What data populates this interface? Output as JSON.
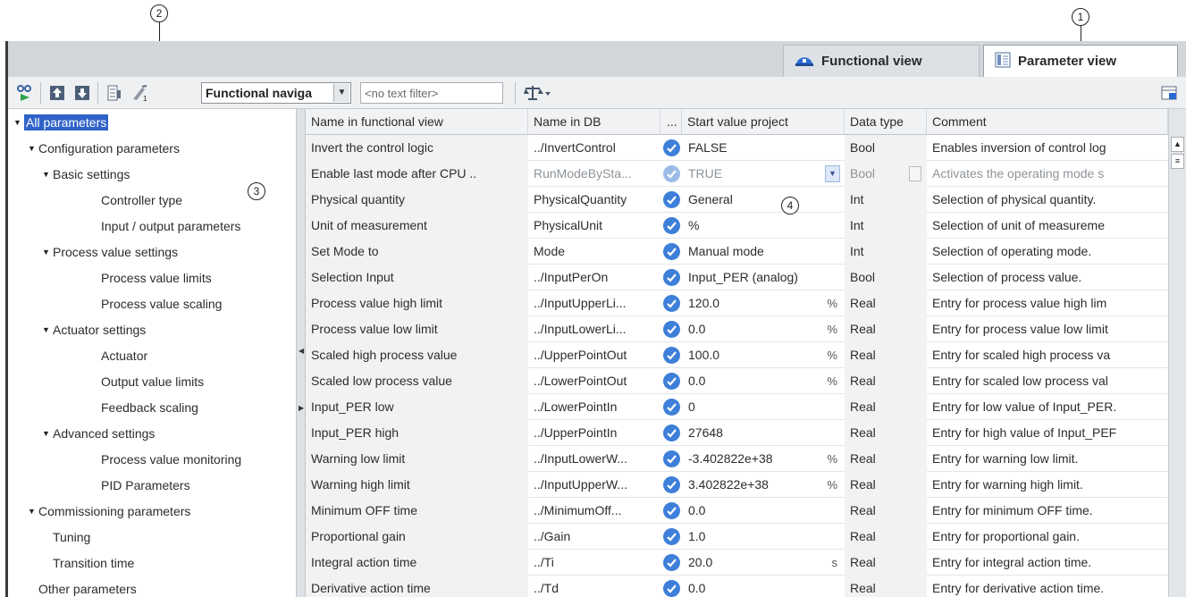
{
  "callouts": {
    "c1": "1",
    "c2": "2",
    "c3": "3",
    "c4": "4"
  },
  "tabs": {
    "functional": {
      "label": "Functional view",
      "icon": "functional-view-icon"
    },
    "parameter": {
      "label": "Parameter view",
      "icon": "parameter-view-icon",
      "active": true
    }
  },
  "toolbar": {
    "navigation_select": "Functional naviga",
    "text_filter_placeholder": "<no text filter>",
    "icons": [
      "monitor-icon",
      "load-start-values-icon",
      "save-start-values-icon",
      "snapshot-icon",
      "initialize-icon",
      "compare-icon",
      "layout-icon"
    ]
  },
  "tree": [
    {
      "label": "All parameters",
      "level": 0,
      "expanded": true,
      "selected": true
    },
    {
      "label": "Configuration parameters",
      "level": 1,
      "expanded": true
    },
    {
      "label": "Basic settings",
      "level": 2,
      "expanded": true
    },
    {
      "label": "Controller type",
      "level": 3
    },
    {
      "label": "Input / output parameters",
      "level": 3
    },
    {
      "label": "Process value settings",
      "level": 2,
      "expanded": true
    },
    {
      "label": "Process value limits",
      "level": 3
    },
    {
      "label": "Process value scaling",
      "level": 3
    },
    {
      "label": "Actuator settings",
      "level": 2,
      "expanded": true
    },
    {
      "label": "Actuator",
      "level": 3
    },
    {
      "label": "Output value limits",
      "level": 3
    },
    {
      "label": "Feedback scaling",
      "level": 3
    },
    {
      "label": "Advanced settings",
      "level": 2,
      "expanded": true
    },
    {
      "label": "Process value monitoring",
      "level": 3
    },
    {
      "label": "PID Parameters",
      "level": 3
    },
    {
      "label": "Commissioning parameters",
      "level": 1,
      "expanded": true
    },
    {
      "label": "Tuning",
      "level": 2
    },
    {
      "label": "Transition time",
      "level": 2
    },
    {
      "label": "Other parameters",
      "level": 1
    }
  ],
  "table": {
    "headers": {
      "name_functional": "Name in functional view",
      "name_db": "Name in DB",
      "dots": "...",
      "start_value": "Start value project",
      "data_type": "Data type",
      "comment": "Comment"
    },
    "rows": [
      {
        "name": "Invert the control logic",
        "db": "../InvertControl",
        "value": "FALSE",
        "unit": "",
        "type": "Bool",
        "comment": "Enables inversion of control log"
      },
      {
        "name": "Enable last mode after CPU ..",
        "db": "RunModeBySta...",
        "value": "TRUE",
        "unit": "",
        "type": "Bool",
        "comment": "Activates the operating mode s",
        "disabled": true
      },
      {
        "name": "Physical quantity",
        "db": "PhysicalQuantity",
        "value": "General",
        "unit": "",
        "type": "Int",
        "comment": "Selection of physical quantity."
      },
      {
        "name": "Unit of measurement",
        "db": "PhysicalUnit",
        "value": "%",
        "unit": "",
        "type": "Int",
        "comment": "Selection of unit of measureme"
      },
      {
        "name": "Set Mode to",
        "db": "Mode",
        "value": "Manual mode",
        "unit": "",
        "type": "Int",
        "comment": "Selection of operating mode."
      },
      {
        "name": "Selection Input",
        "db": "../InputPerOn",
        "value": "Input_PER (analog)",
        "unit": "",
        "type": "Bool",
        "comment": "Selection of process value."
      },
      {
        "name": "Process value high limit",
        "db": "../InputUpperLi...",
        "value": "120.0",
        "unit": "%",
        "type": "Real",
        "comment": "Entry for process value high lim"
      },
      {
        "name": "Process value low limit",
        "db": "../InputLowerLi...",
        "value": "0.0",
        "unit": "%",
        "type": "Real",
        "comment": "Entry for process value low limit"
      },
      {
        "name": "Scaled high process value",
        "db": "../UpperPointOut",
        "value": "100.0",
        "unit": "%",
        "type": "Real",
        "comment": "Entry for scaled high process va"
      },
      {
        "name": "Scaled low process value",
        "db": "../LowerPointOut",
        "value": "0.0",
        "unit": "%",
        "type": "Real",
        "comment": "Entry for scaled low process val"
      },
      {
        "name": "Input_PER low",
        "db": "../LowerPointIn",
        "value": "0",
        "unit": "",
        "type": "Real",
        "comment": "Entry for low value of Input_PER."
      },
      {
        "name": "Input_PER high",
        "db": "../UpperPointIn",
        "value": "27648",
        "unit": "",
        "type": "Real",
        "comment": "Entry for high value of Input_PEF"
      },
      {
        "name": "Warning low limit",
        "db": "../InputLowerW...",
        "value": "-3.402822e+38",
        "unit": "%",
        "type": "Real",
        "comment": "Entry for warning low limit."
      },
      {
        "name": "Warning high limit",
        "db": "../InputUpperW...",
        "value": "3.402822e+38",
        "unit": "%",
        "type": "Real",
        "comment": "Entry for warning high limit."
      },
      {
        "name": "Minimum OFF time",
        "db": "../MinimumOff...",
        "value": "0.0",
        "unit": "",
        "type": "Real",
        "comment": "Entry for minimum OFF time."
      },
      {
        "name": "Proportional gain",
        "db": "../Gain",
        "value": "1.0",
        "unit": "",
        "type": "Real",
        "comment": "Entry for proportional gain."
      },
      {
        "name": "Integral action time",
        "db": "../Ti",
        "value": "20.0",
        "unit": "s",
        "type": "Real",
        "comment": "Entry for integral action time."
      },
      {
        "name": "Derivative action time",
        "db": "../Td",
        "value": "0.0",
        "unit": "",
        "type": "Real",
        "comment": "Entry for derivative action time."
      }
    ]
  },
  "colors": {
    "selection": "#2f63c9",
    "check": "#3d7fd9",
    "tab_bar": "#d2d6db"
  }
}
